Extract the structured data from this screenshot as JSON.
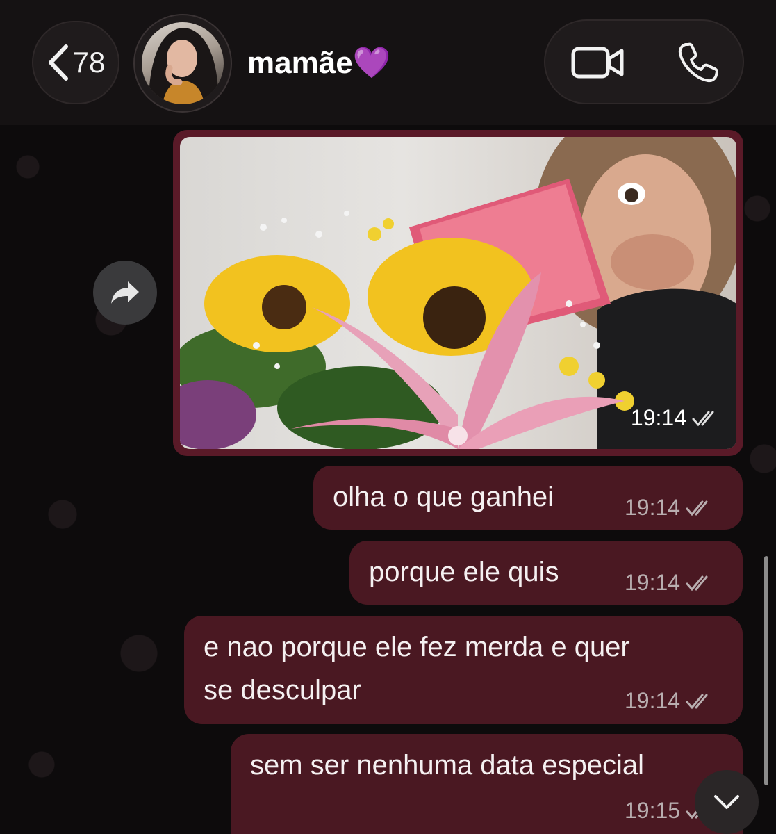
{
  "header": {
    "back_count": "78",
    "contact_name": "mamãe💜",
    "icons": {
      "back": "chevron-left-icon",
      "video": "video-camera-icon",
      "phone": "phone-icon"
    }
  },
  "messages": [
    {
      "type": "image",
      "time": "19:14",
      "status": "read-double-check",
      "caption": ""
    },
    {
      "type": "text",
      "text": "olha o que ganhei",
      "time": "19:14",
      "status": "read-double-check"
    },
    {
      "type": "text",
      "text": "porque ele quis",
      "time": "19:14",
      "status": "read-double-check"
    },
    {
      "type": "text",
      "text_line1": "e nao porque ele fez merda e quer",
      "text_line2": "se desculpar",
      "time": "19:14",
      "status": "read-double-check"
    },
    {
      "type": "text",
      "text": "sem ser nenhuma data especial",
      "time": "19:15",
      "status": "read-double-check"
    }
  ],
  "colors": {
    "outgoing_bubble": "#4a1822",
    "image_bubble": "#5a1a28",
    "header_bg": "#151213",
    "chat_bg": "#0d0b0c"
  }
}
